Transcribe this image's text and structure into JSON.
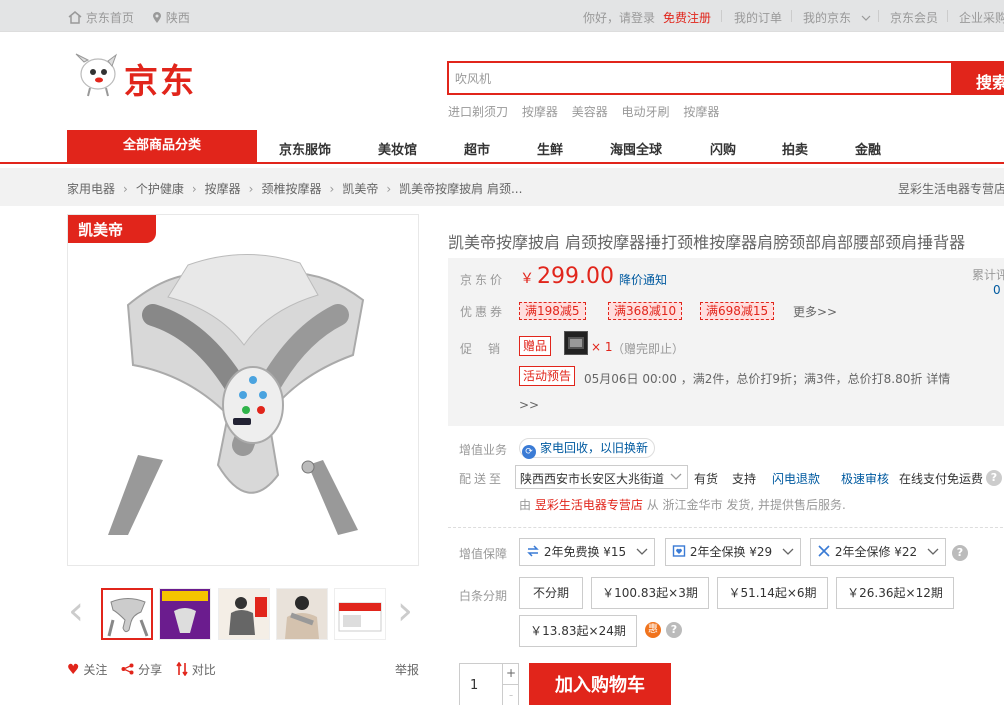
{
  "topbar": {
    "home": "京东首页",
    "location": "陕西",
    "greeting": "你好，请登录",
    "register": "免费注册",
    "my_orders": "我的订单",
    "my_jd": "我的京东",
    "member": "京东会员",
    "enterprise": "企业采购"
  },
  "logo": {
    "text": "京东"
  },
  "search": {
    "value": "吹风机",
    "button": "搜索"
  },
  "hotwords": [
    "进口剃须刀",
    "按摩器",
    "美容器",
    "电动牙刷",
    "按摩器"
  ],
  "nav": {
    "category": "全部商品分类",
    "items": [
      "京东服饰",
      "美妆馆",
      "超市",
      "生鲜",
      "海囤全球",
      "闪购",
      "拍卖",
      "金融"
    ]
  },
  "breadcrumb": [
    "家用电器",
    "个护健康",
    "按摩器",
    "颈椎按摩器",
    "凯美帝",
    "凯美帝按摩披肩 肩颈..."
  ],
  "shop_name": "昱彩生活电器专营店",
  "product": {
    "brand_tag": "凯美帝",
    "title": "凯美帝按摩披肩 肩颈按摩器捶打颈椎按摩器肩膀颈部肩部腰部颈肩捶背器",
    "thumbnails": [
      "thumb-1",
      "thumb-2",
      "thumb-3",
      "thumb-4",
      "thumb-5"
    ],
    "actions": {
      "follow": "关注",
      "share": "分享",
      "compare": "对比",
      "report": "举报"
    }
  },
  "price": {
    "label": "京东价",
    "currency": "￥",
    "value": "299.00",
    "notify": "降价通知",
    "cumulative_label": "累计评价",
    "cumulative_count": "0"
  },
  "coupons": {
    "label": "优惠券",
    "items": [
      "满198减5",
      "满368减10",
      "满698减15"
    ],
    "more": "更多>>"
  },
  "promotion": {
    "label": "促销",
    "gift_tag": "赠品",
    "gift_qty": "× 1",
    "gift_note": "（赠完即止）",
    "preview_tag": "活动预告",
    "preview_text": "05月06日 00:00 ，满2件，总价打9折；满3件，总价打8.80折 详情",
    "preview_more": ">>"
  },
  "service": {
    "label": "增值业务",
    "recycle": "家电回收，以旧换新"
  },
  "delivery": {
    "label": "配送至",
    "address": "陕西西安市长安区大兆街道",
    "stock": "有货",
    "support": "支持",
    "links": [
      "闪电退款",
      "极速审核"
    ],
    "pay": "在线支付免运费",
    "ship_prefix": "由",
    "ship_shop": "昱彩生活电器专营店",
    "ship_suffix": "从 浙江金华市 发货, 并提供售后服务."
  },
  "warranty": {
    "label": "增值保障",
    "options": [
      "2年免费换 ¥15",
      "2年全保换 ¥29",
      "2年全保修 ¥22"
    ]
  },
  "installment": {
    "label": "白条分期",
    "options": [
      "不分期",
      "￥100.83起×3期",
      "￥51.14起×6期",
      "￥26.36起×12期",
      "￥13.83起×24期"
    ],
    "hui": "惠"
  },
  "buy": {
    "quantity": "1",
    "plus": "+",
    "minus": "-",
    "add_to_cart": "加入购物车"
  },
  "colors": {
    "brand_red": "#e1251b",
    "link_blue": "#005aa0"
  }
}
